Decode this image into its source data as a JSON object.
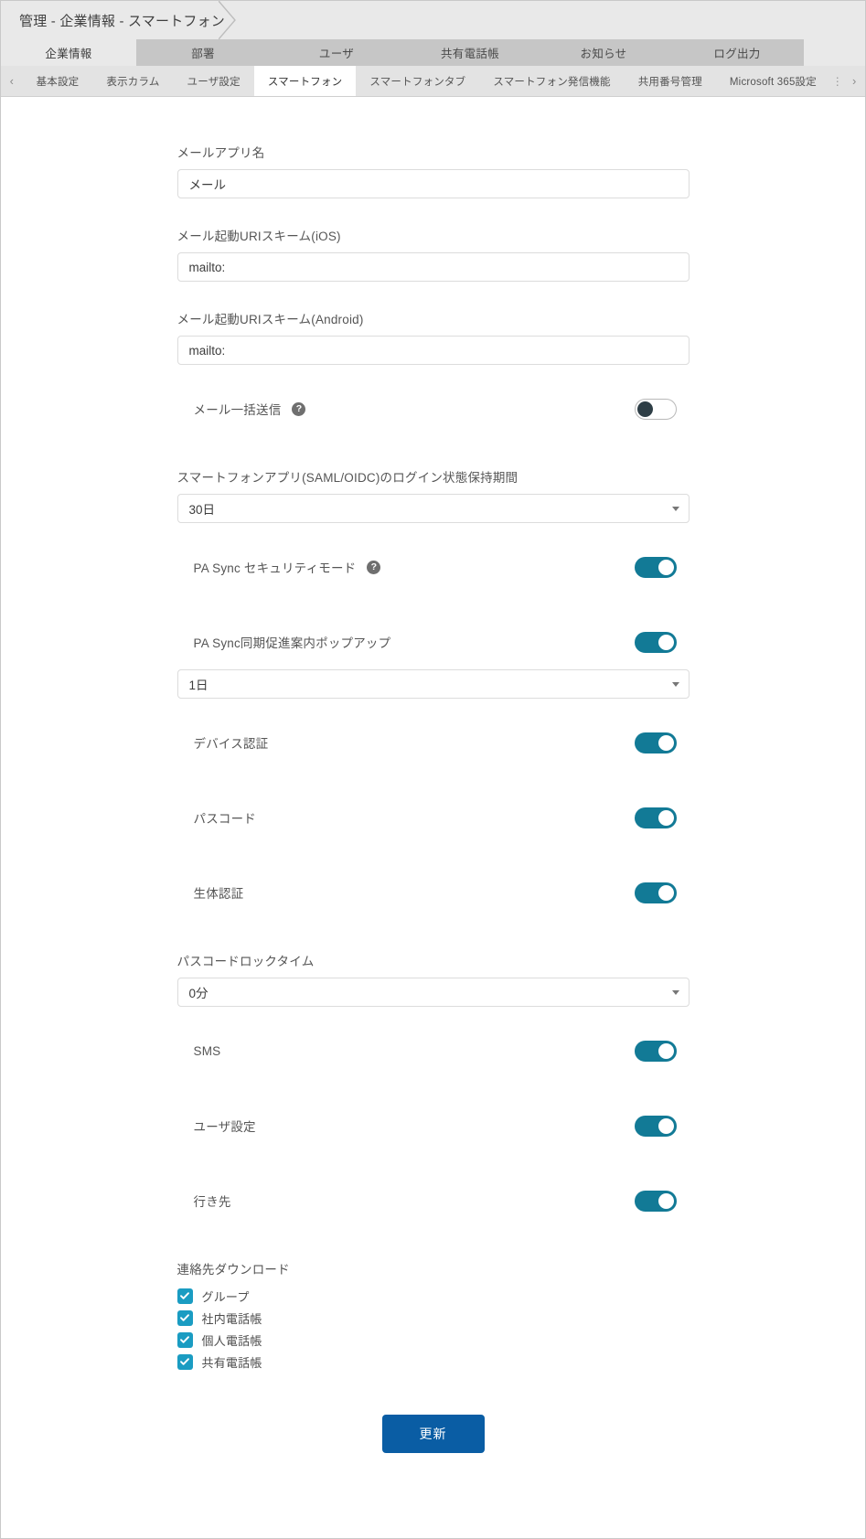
{
  "breadcrumb": {
    "text": "管理 - 企業情報 - スマートフォン"
  },
  "primary_tabs": [
    {
      "label": "企業情報",
      "active": true
    },
    {
      "label": "部署",
      "active": false
    },
    {
      "label": "ユーザ",
      "active": false
    },
    {
      "label": "共有電話帳",
      "active": false
    },
    {
      "label": "お知らせ",
      "active": false
    },
    {
      "label": "ログ出力",
      "active": false
    }
  ],
  "secondary_tabs": {
    "scroll_left": "‹",
    "scroll_right": "›",
    "overflow_dots": "⋮",
    "items": [
      {
        "label": "基本設定",
        "active": false
      },
      {
        "label": "表示カラム",
        "active": false
      },
      {
        "label": "ユーザ設定",
        "active": false
      },
      {
        "label": "スマートフォン",
        "active": true
      },
      {
        "label": "スマートフォンタブ",
        "active": false
      },
      {
        "label": "スマートフォン発信機能",
        "active": false
      },
      {
        "label": "共用番号管理",
        "active": false
      },
      {
        "label": "Microsoft 365設定",
        "active": false
      }
    ]
  },
  "form": {
    "mail_app_name": {
      "label": "メールアプリ名",
      "value": "メール",
      "placeholder": ""
    },
    "mail_uri_ios": {
      "label": "メール起動URIスキーム(iOS)",
      "value": "mailto:",
      "placeholder": ""
    },
    "mail_uri_android": {
      "label": "メール起動URIスキーム(Android)",
      "value": "mailto:",
      "placeholder": ""
    },
    "mail_bulk_send": {
      "label": "メール一括送信",
      "help": "?",
      "state": "off"
    },
    "saml_login_retention": {
      "label": "スマートフォンアプリ(SAML/OIDC)のログイン状態保持期間",
      "value": "30日"
    },
    "pa_sync_security_mode": {
      "label": "PA Sync セキュリティモード",
      "help": "?",
      "state": "on"
    },
    "pa_sync_popup": {
      "label": "PA Sync同期促進案内ポップアップ",
      "state": "on",
      "interval_value": "1日"
    },
    "device_auth": {
      "label": "デバイス認証",
      "state": "on"
    },
    "passcode": {
      "label": "パスコード",
      "state": "on"
    },
    "biometric_auth": {
      "label": "生体認証",
      "state": "on"
    },
    "passcode_lock_time": {
      "label": "パスコードロックタイム",
      "value": "0分"
    },
    "sms": {
      "label": "SMS",
      "state": "on"
    },
    "user_settings": {
      "label": "ユーザ設定",
      "state": "on"
    },
    "destination": {
      "label": "行き先",
      "state": "on"
    },
    "contact_download": {
      "label": "連絡先ダウンロード",
      "options": [
        {
          "label": "グループ",
          "checked": true
        },
        {
          "label": "社内電話帳",
          "checked": true
        },
        {
          "label": "個人電話帳",
          "checked": true
        },
        {
          "label": "共有電話帳",
          "checked": true
        }
      ]
    },
    "submit": {
      "label": "更新"
    }
  },
  "colors": {
    "toggle_on": "#127a96",
    "toggle_off_knob": "#2e3e46",
    "checkbox": "#1a9cc2",
    "submit": "#0a5da4"
  }
}
